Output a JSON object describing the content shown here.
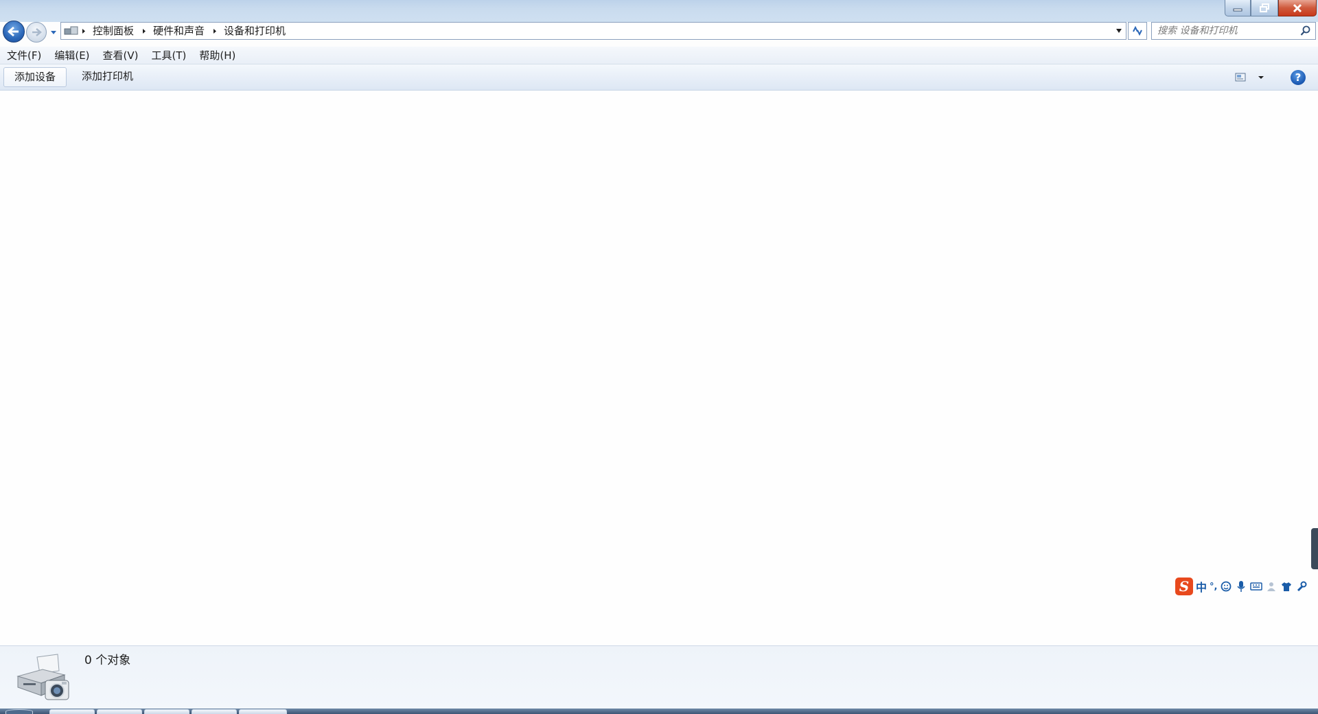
{
  "window": {
    "buttons": [
      "minimize",
      "restore",
      "close"
    ]
  },
  "nav": {
    "breadcrumbs": [
      "控制面板",
      "硬件和声音",
      "设备和打印机"
    ],
    "search_placeholder": "搜索 设备和打印机"
  },
  "menu": {
    "items": [
      "文件(F)",
      "编辑(E)",
      "查看(V)",
      "工具(T)",
      "帮助(H)"
    ]
  },
  "commands": {
    "add_device": "添加设备",
    "add_printer": "添加打印机",
    "help": "?"
  },
  "ime": {
    "logo": "S",
    "mode": "中",
    "punct": "°,"
  },
  "details": {
    "count": "0 个对象"
  },
  "colors": {
    "accent": "#2b67b8",
    "close_red": "#c8391b",
    "ime_orange": "#e8491d"
  }
}
